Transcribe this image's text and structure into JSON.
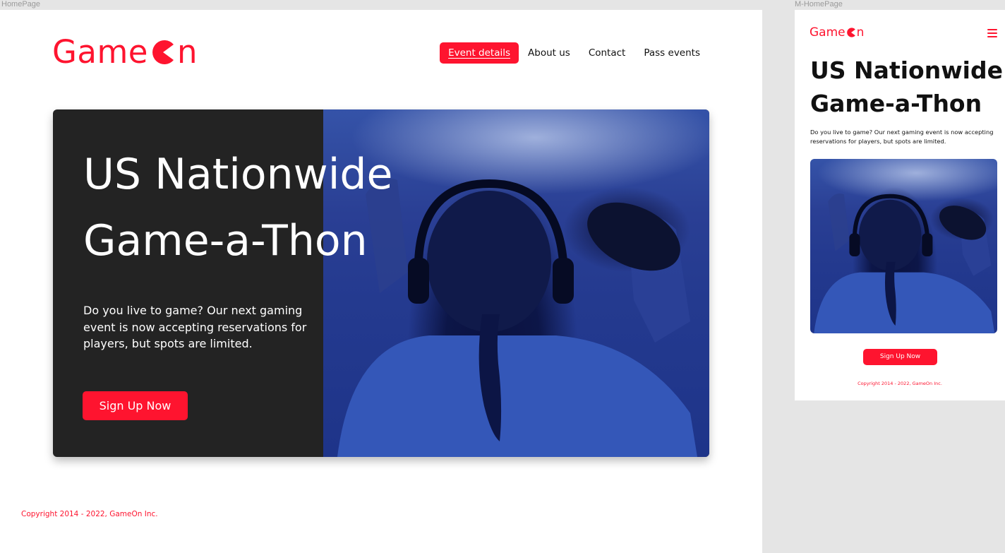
{
  "frames": {
    "desktop_label": "HomePage",
    "mobile_label": "M-HomePage"
  },
  "brand": {
    "logo_text_before": "Game",
    "logo_text_after": "n",
    "logo_icon": "pacman-icon",
    "accent_color": "#fe142f"
  },
  "nav": {
    "items": [
      {
        "label": "Event details",
        "active": true
      },
      {
        "label": "About us",
        "active": false
      },
      {
        "label": "Contact",
        "active": false
      },
      {
        "label": "Pass events",
        "active": false
      }
    ]
  },
  "hero": {
    "title_line1": "US Nationwide",
    "title_line2": "Game-a-Thon",
    "description": "Do you live to game? Our next gaming event is now accepting reservations for players, but spots are limited.",
    "cta_label": "Sign Up Now",
    "image_subject": "gamer-with-headphones-holding-controller"
  },
  "footer": {
    "copyright": "Copyright 2014 - 2022, GameOn Inc."
  },
  "mobile": {
    "menu_icon": "hamburger-icon"
  }
}
